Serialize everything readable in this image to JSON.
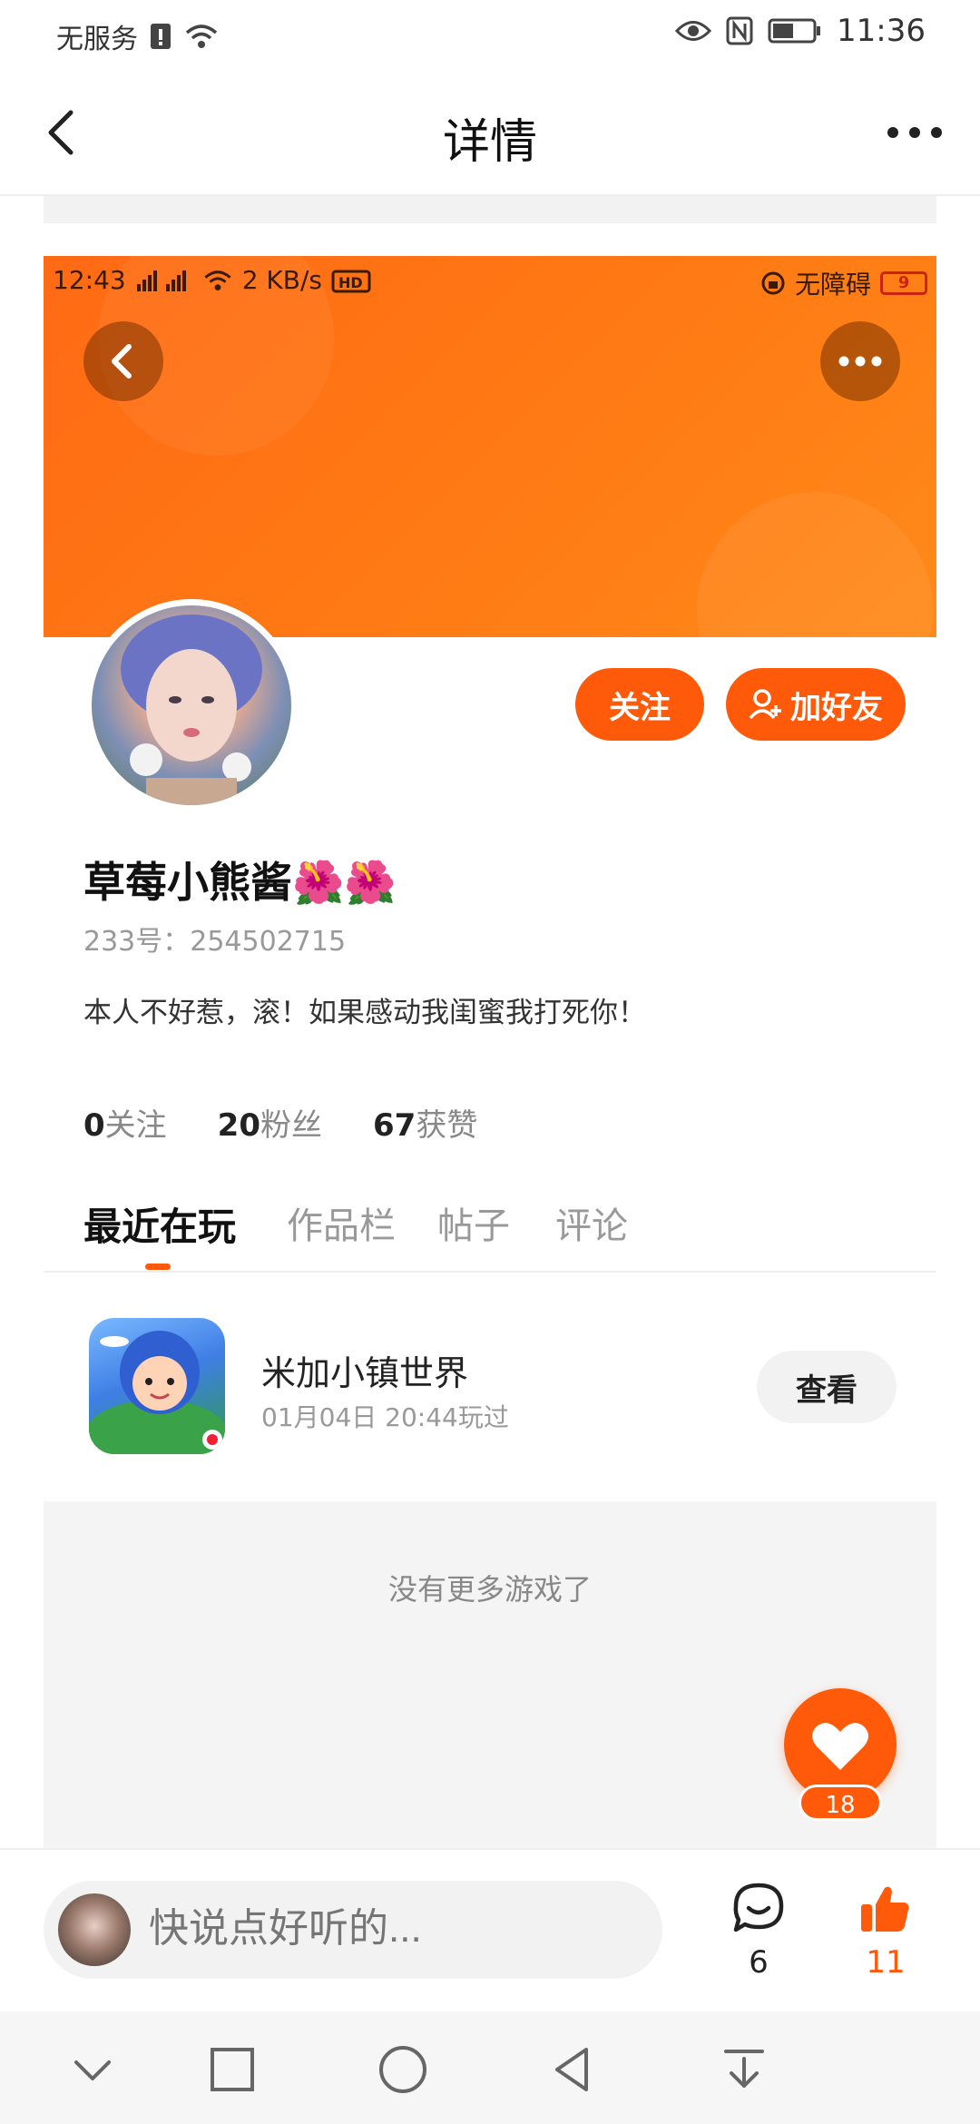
{
  "status_bar": {
    "carrier": "无服务",
    "time": "11:36"
  },
  "header": {
    "title": "详情"
  },
  "embedded": {
    "time": "12:43",
    "speed": "2 KB/s",
    "accessibility": "无障碍",
    "battery": "9"
  },
  "profile": {
    "name": "草莓小熊酱🌺🌺",
    "uid": "233号：254502715",
    "bio": "本人不好惹，滚！如果感动我闺蜜我打死你！",
    "follow_label": "关注",
    "add_friend_label": "加好友",
    "stats": [
      {
        "value": "0",
        "label": "关注"
      },
      {
        "value": "20",
        "label": "粉丝"
      },
      {
        "value": "67",
        "label": "获赞"
      }
    ]
  },
  "tabs": [
    {
      "label": "最近在玩",
      "active": true
    },
    {
      "label": "作品栏",
      "active": false
    },
    {
      "label": "帖子",
      "active": false
    },
    {
      "label": "评论",
      "active": false
    }
  ],
  "game": {
    "name": "米加小镇世界",
    "played_time": "01月04日 20:44玩过",
    "view_label": "查看"
  },
  "empty_text": "没有更多游戏了",
  "like_fab": {
    "count": "18"
  },
  "bottom": {
    "input_placeholder": "快说点好听的...",
    "comment_count": "6",
    "like_count": "11"
  },
  "colors": {
    "accent": "#ff5a0a",
    "banner": "#ff7a14"
  },
  "icons": [
    "back-icon",
    "more-icon",
    "eye-icon",
    "nfc-icon",
    "battery-icon",
    "wifi-icon",
    "add-friend-icon",
    "heart-icon",
    "comment-icon",
    "thumb-up-icon",
    "nav-collapse-icon",
    "nav-recent-icon",
    "nav-home-icon",
    "nav-back-icon",
    "nav-notification-icon"
  ]
}
